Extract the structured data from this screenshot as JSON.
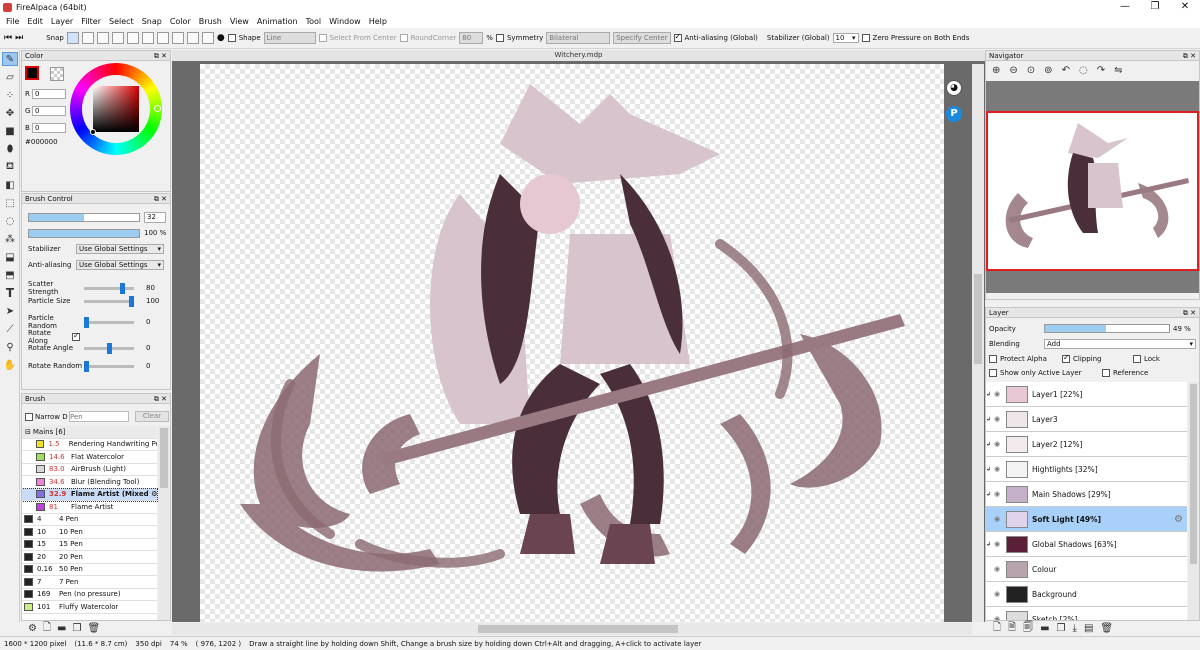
{
  "window": {
    "title": "FireAlpaca (64bit)",
    "controls": [
      "—",
      "❐",
      "✕"
    ]
  },
  "menu": [
    "File",
    "Edit",
    "Layer",
    "Filter",
    "Select",
    "Snap",
    "Color",
    "Brush",
    "View",
    "Animation",
    "Tool",
    "Window",
    "Help"
  ],
  "toolbar": {
    "snap_label": "Snap",
    "shape_label": "Shape",
    "shape_value": "Line",
    "select_from_center": "Select From Center",
    "round_corner": "RoundCorner",
    "round_corner_value": "80",
    "percent": "%",
    "symmetry": "Symmetry",
    "symmetry_value": "Bilateral",
    "specify_center": "Specify Center",
    "antialias": "Anti-aliasing (Global)",
    "stabilizer_label": "Stabilizer (Global)",
    "stabilizer_value": "10",
    "zero_pressure": "Zero Pressure on Both Ends"
  },
  "color_panel": {
    "title": "Color",
    "r_label": "R",
    "r": "0",
    "g_label": "G",
    "g": "0",
    "b_label": "B",
    "b": "0",
    "hex": "#000000"
  },
  "brush_control": {
    "title": "Brush Control",
    "size": "32",
    "opacity": "100 %",
    "stabilizer_label": "Stabilizer",
    "stabilizer_value": "Use Global Settings",
    "antialias_label": "Anti-aliasing",
    "antialias_value": "Use Global Settings",
    "scatter_label": "Scatter Strength",
    "scatter_value": "80",
    "particle_size_label": "Particle Size",
    "particle_size_value": "100",
    "particle_random_label": "Particle Random",
    "particle_random_value": "0",
    "rotate_along_label": "Rotate Along",
    "rotate_angle_label": "Rotate Angle",
    "rotate_angle_value": "0",
    "rotate_random_label": "Rotate Random",
    "rotate_random_value": "0",
    "levels": {
      "size": 0.5,
      "opacity": 1.0,
      "scatter": 0.8,
      "particle_size": 1.0,
      "particle_random": 0,
      "rotate_angle": 0.5,
      "rotate_random": 0
    }
  },
  "brush_panel": {
    "title": "Brush",
    "narrow_label": "Narrow D",
    "search_placeholder": "Pen",
    "clear_label": "Clear",
    "group": "Mains [6]",
    "group_items": [
      {
        "size": "1.5",
        "name": "Rendering Handwriting Pen",
        "color": "#f0e020"
      },
      {
        "size": "14.6",
        "name": "Flat Watercolor",
        "color": "#a0e060"
      },
      {
        "size": "83.0",
        "name": "AirBrush (Light)",
        "color": "#d8d8d8"
      },
      {
        "size": "34.6",
        "name": "Blur (Blending Tool)",
        "color": "#f080e0"
      },
      {
        "size": "32.9",
        "name": "Flame Artist (Mixed ⚙",
        "color": "#8070e8"
      },
      {
        "size": "81",
        "name": "Flame Artist",
        "color": "#c040e0"
      }
    ],
    "items": [
      {
        "size": "4",
        "name": "4 Pen",
        "color": "#222"
      },
      {
        "size": "10",
        "name": "10 Pen",
        "color": "#222"
      },
      {
        "size": "15",
        "name": "15 Pen",
        "color": "#222"
      },
      {
        "size": "20",
        "name": "20 Pen",
        "color": "#222"
      },
      {
        "size": "0.16",
        "name": "50 Pen",
        "color": "#222"
      },
      {
        "size": "7",
        "name": "7 Pen",
        "color": "#222"
      },
      {
        "size": "169",
        "name": "Pen (no pressure)",
        "color": "#222"
      },
      {
        "size": "101",
        "name": "Fluffy Watercolor",
        "color": "#c8f080"
      }
    ]
  },
  "canvas": {
    "tab_title": "Witchery.mdp"
  },
  "navigator": {
    "title": "Navigator"
  },
  "layer_panel": {
    "title": "Layer",
    "opacity_label": "Opacity",
    "opacity_value": "49 %",
    "opacity_level": 0.49,
    "blending_label": "Blending",
    "blending_value": "Add",
    "protect_alpha": "Protect Alpha",
    "clipping": "Clipping",
    "lock": "Lock",
    "show_active": "Show only Active Layer",
    "reference": "Reference",
    "layers": [
      {
        "name": "Layer1 [22%]",
        "thumb": "#e8c8d4"
      },
      {
        "name": "Layer3",
        "thumb": "#efe6ea"
      },
      {
        "name": "Layer2 [12%]",
        "thumb": "#f3eaed"
      },
      {
        "name": "Hightlights [32%]",
        "thumb": "#f4f4f4"
      },
      {
        "name": "Main Shadows [29%]",
        "thumb": "#c4b0c8"
      },
      {
        "name": "Soft Light [49%]",
        "thumb": "#e0d4ec"
      },
      {
        "name": "Global Shadows [63%]",
        "thumb": "#5a2038"
      },
      {
        "name": "Colour",
        "thumb": "#b8a4ac"
      },
      {
        "name": "Background",
        "thumb": "#222"
      },
      {
        "name": "Sketch [2%]",
        "thumb": "#ddd"
      }
    ]
  },
  "statusbar": {
    "size": "1600 * 1200 pixel",
    "cm": "(11.6 * 8.7 cm)",
    "dpi": "350 dpi",
    "zoom": "74 %",
    "coords": "( 976, 1202 )",
    "hint": "Draw a straight line by holding down Shift, Change a brush size by holding down Ctrl+Alt and dragging, A+click to activate layer"
  },
  "colors": {
    "accent": "#1a78d8",
    "active_layer": "#a8d0f8",
    "canvas_bg": "#6a6a6a"
  }
}
